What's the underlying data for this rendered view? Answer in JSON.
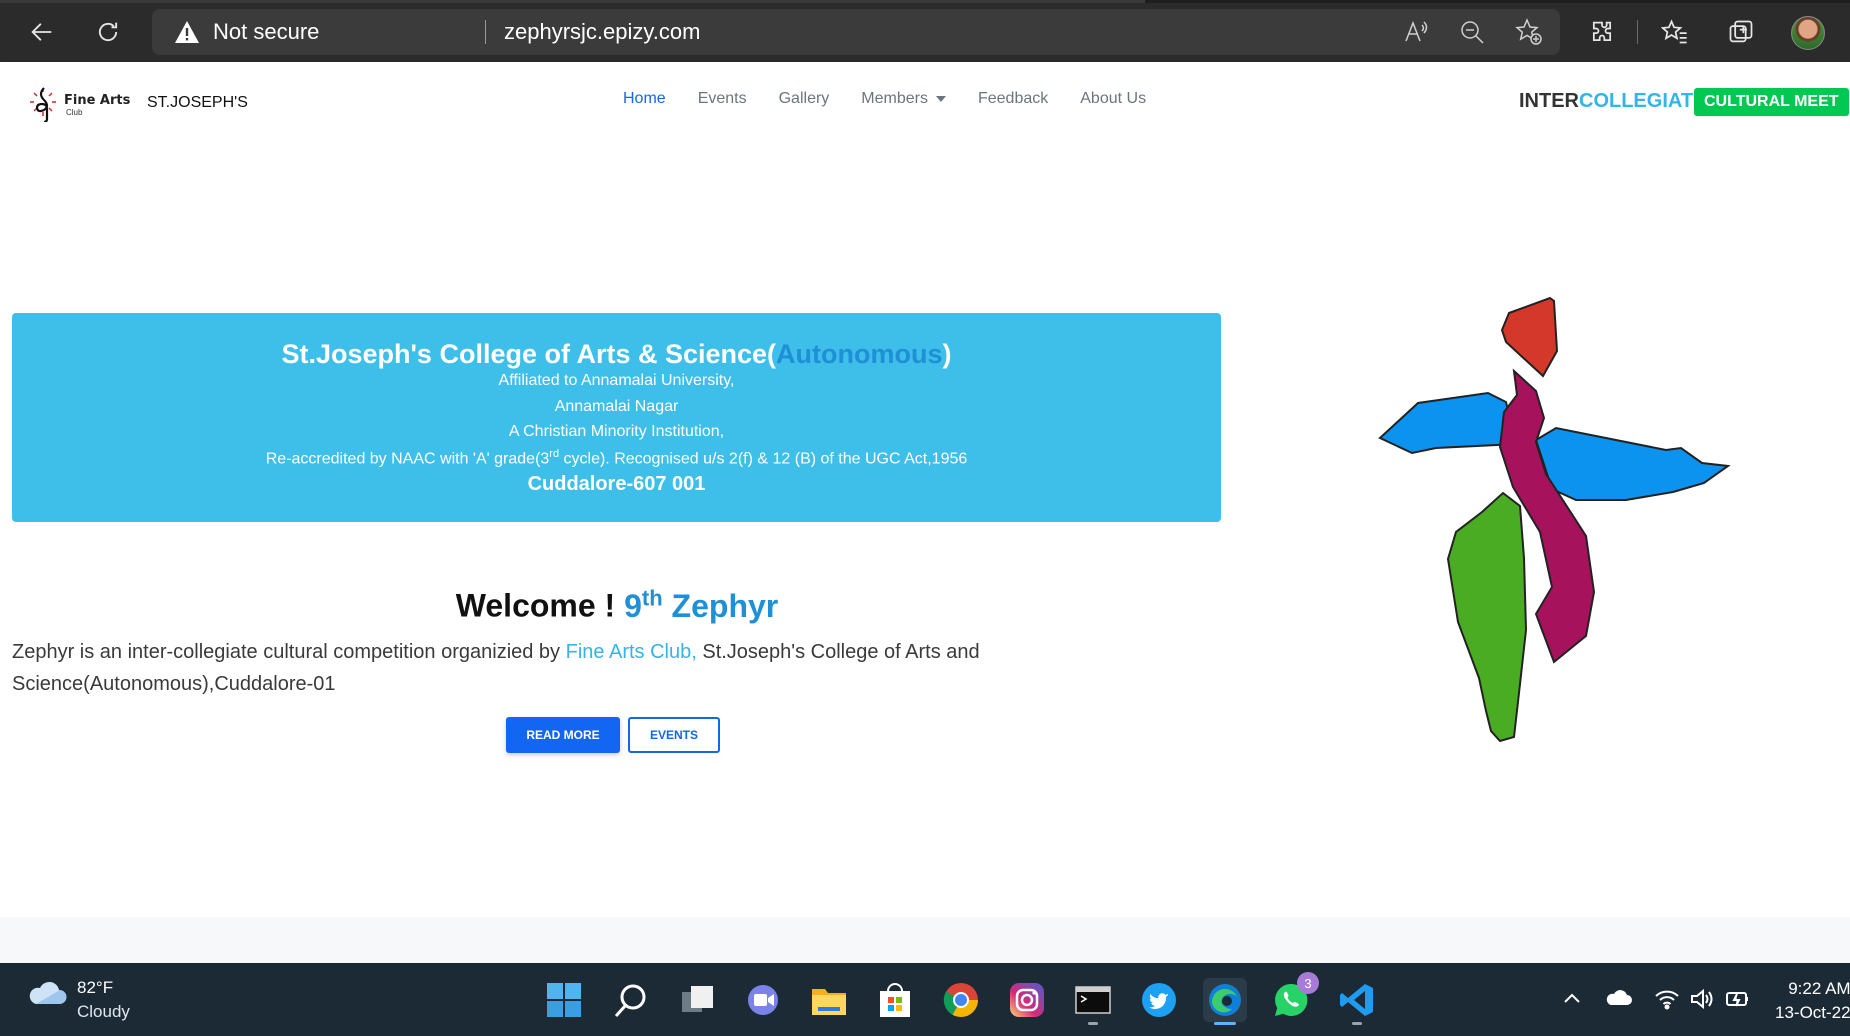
{
  "browser": {
    "security_label": "Not secure",
    "url": "zephyrsjc.epizy.com"
  },
  "navbar": {
    "brand_logo_text": "Fine Arts",
    "brand_logo_sub": "Club",
    "brand_name": "ST.JOSEPH'S",
    "links": [
      {
        "label": "Home",
        "active": true
      },
      {
        "label": "Events"
      },
      {
        "label": "Gallery"
      },
      {
        "label": "Members",
        "dropdown": true
      },
      {
        "label": "Feedback"
      },
      {
        "label": "About Us"
      }
    ],
    "intercollegiate_part1": "INTER",
    "intercollegiate_part2": "COLLEGIATE",
    "badge": "CULTURAL MEET"
  },
  "college": {
    "title_prefix": "St.Joseph's College of Arts & Science(",
    "title_auto": "Autonomous",
    "title_suffix": ")",
    "line1": "Affiliated to Annamalai University,",
    "line2": "Annamalai Nagar",
    "line3": "A Christian Minority Institution,",
    "line4_prefix": "Re-accredited by NAAC with 'A' grade(3",
    "line4_sup": "rd",
    "line4_suffix": " cycle). Recognised u/s 2(f) & 12 (B) of the UGC Act,1956",
    "city": "Cuddalore-607 001"
  },
  "welcome": {
    "prefix": "Welcome ! ",
    "num": "9",
    "sup": "th",
    "name": " Zephyr"
  },
  "intro": {
    "text1": "Zephyr is an inter-collegiate cultural competition organizied by ",
    "club": "Fine Arts Club,",
    "text2": " St.Joseph's College of Arts and Science(Autonomous),Cuddalore-01"
  },
  "buttons": {
    "read_more": "READ MORE",
    "events": "EVENTS"
  },
  "colors": {
    "primary": "#1266f1",
    "info": "#33b5e5",
    "banner": "#3dbfea",
    "success": "#00c851"
  },
  "taskbar": {
    "weather_temp": "82°F",
    "weather_cond": "Cloudy",
    "whatsapp_badge": "3",
    "time": "9:22 AM",
    "date": "13-Oct-22"
  }
}
